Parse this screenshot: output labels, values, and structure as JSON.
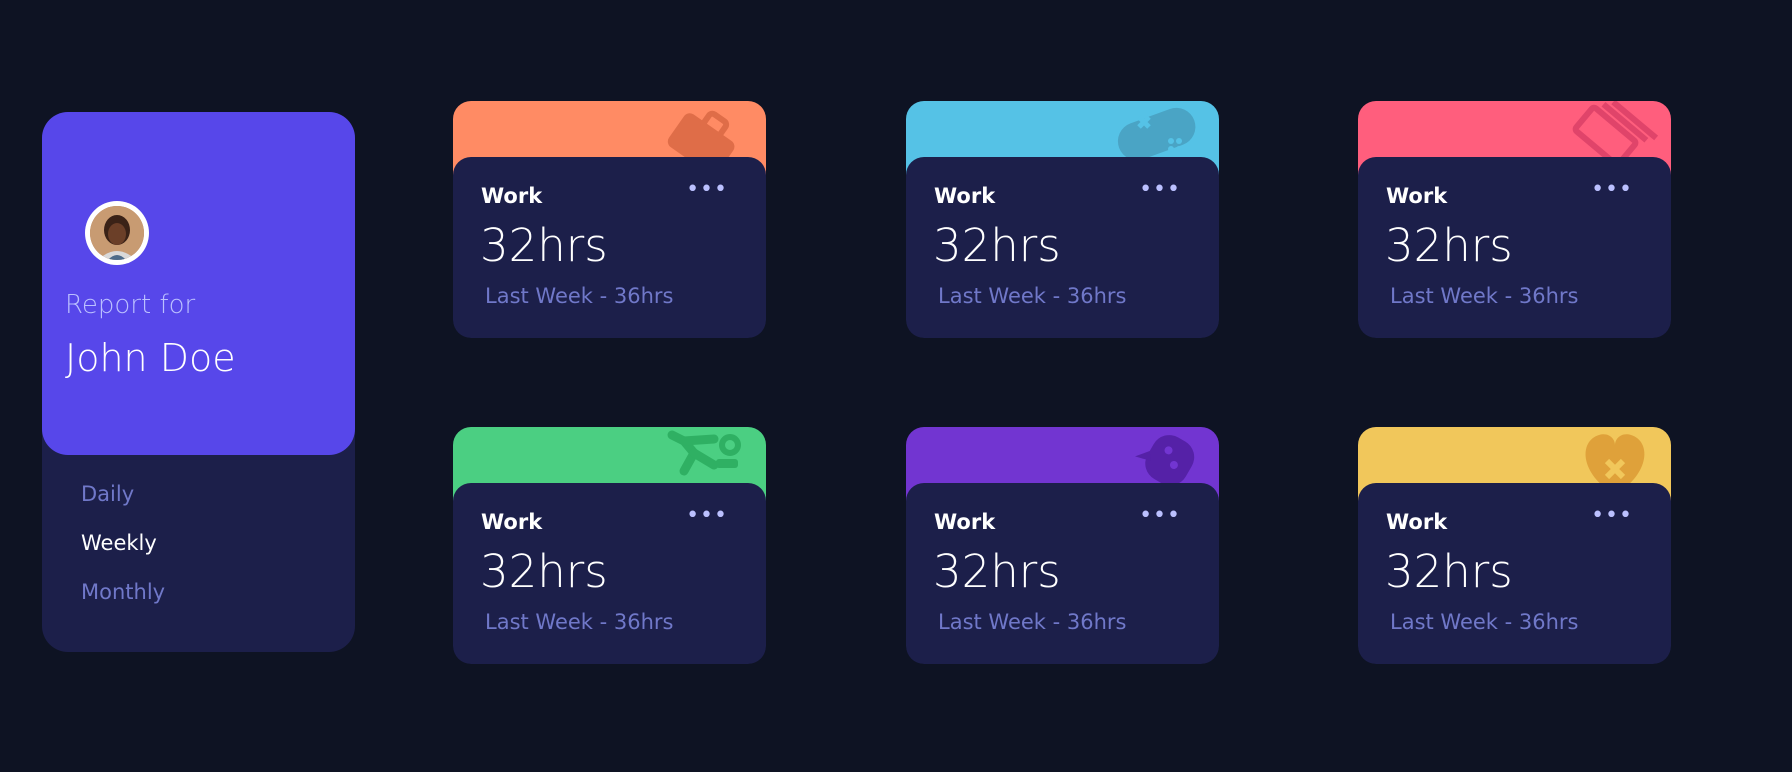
{
  "profile": {
    "report_label": "Report for",
    "name": "John Doe",
    "periods": [
      {
        "label": "Daily",
        "active": false
      },
      {
        "label": "Weekly",
        "active": true
      },
      {
        "label": "Monthly",
        "active": false
      }
    ]
  },
  "cards": [
    {
      "title": "Work",
      "hours": "32hrs",
      "previous": "Last Week - 36hrs",
      "color": "#ff8b64",
      "icon": "briefcase-icon",
      "menu": "•••"
    },
    {
      "title": "Work",
      "hours": "32hrs",
      "previous": "Last Week - 36hrs",
      "color": "#55c2e6",
      "icon": "gamepad-icon",
      "menu": "•••"
    },
    {
      "title": "Work",
      "hours": "32hrs",
      "previous": "Last Week - 36hrs",
      "color": "#ff5e7d",
      "icon": "book-icon",
      "menu": "•••"
    },
    {
      "title": "Work",
      "hours": "32hrs",
      "previous": "Last Week - 36hrs",
      "color": "#4bcf82",
      "icon": "runner-icon",
      "menu": "•••"
    },
    {
      "title": "Work",
      "hours": "32hrs",
      "previous": "Last Week - 36hrs",
      "color": "#7235d1",
      "icon": "chat-bubble-icon",
      "menu": "•••"
    },
    {
      "title": "Work",
      "hours": "32hrs",
      "previous": "Last Week - 36hrs",
      "color": "#f1c75b",
      "icon": "heart-icon",
      "menu": "•••"
    }
  ]
}
